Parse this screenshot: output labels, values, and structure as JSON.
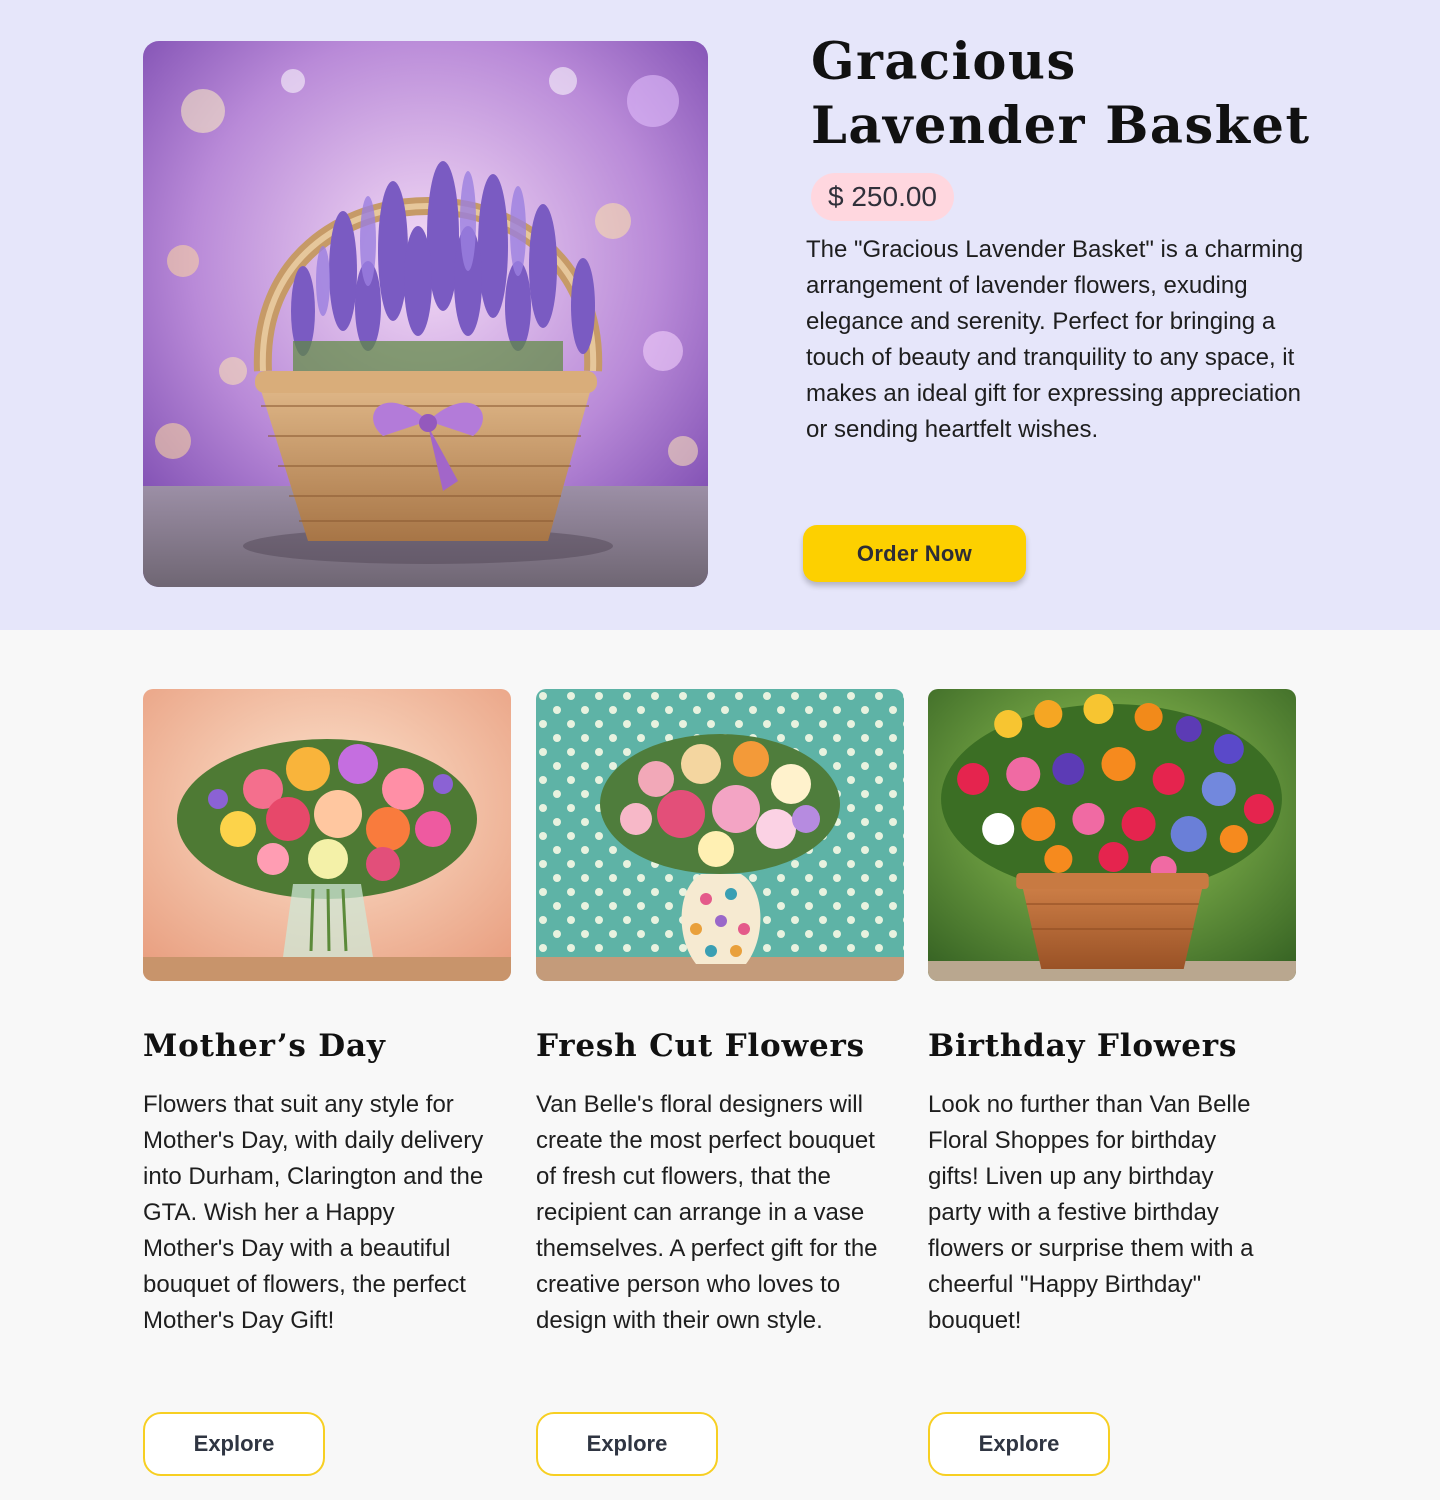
{
  "featured": {
    "title": "Gracious Lavender Basket",
    "price": "$ 250.00",
    "description": "The \"Gracious Lavender Basket\" is a charming arrangement of lavender flowers, exuding elegance and serenity. Perfect for bringing a touch of beauty and tranquility to any space, it makes an ideal gift for expressing appreciation or sending heartfelt wishes.",
    "order_label": "Order Now",
    "accent_color": "#fdd000",
    "price_bg": "#ffd7df",
    "background": "#e6e6fa"
  },
  "categories": [
    {
      "title": "Mother’s Day",
      "description": "Flowers that suit any style for Mother's Day, with daily delivery into Durham, Clarington and the GTA.  Wish her a Happy Mother's Day with a beautiful bouquet of flowers, the perfect Mother's Day Gift!",
      "button_label": "Explore"
    },
    {
      "title": "Fresh Cut Flowers",
      "description": "Van Belle's floral designers will create the most perfect bouquet of fresh cut flowers, that the recipient can arrange in a vase themselves. A perfect gift for the creative person who loves to design with their own style.",
      "button_label": "Explore"
    },
    {
      "title": "Birthday Flowers",
      "description": "Look no further than Van Belle Floral Shoppes for birthday gifts! Liven up any birthday party with a festive birthday flowers or surprise them with a cheerful \"Happy Birthday\" bouquet!",
      "button_label": "Explore"
    }
  ]
}
